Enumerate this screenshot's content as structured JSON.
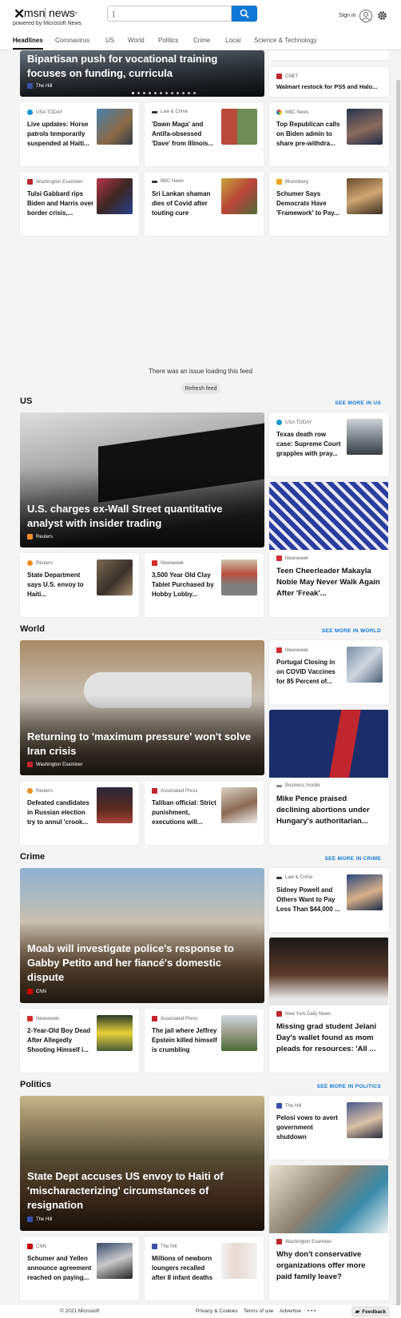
{
  "header": {
    "logo_mark": "✕",
    "logo": "msn",
    "brand": "news",
    "powered": "powered by Microsoft News",
    "search": {
      "value": "|",
      "placeholder": ""
    },
    "signin": "Sign in"
  },
  "nav": [
    "Headlines",
    "Coronavirus",
    "US",
    "World",
    "Politics",
    "Crime",
    "Local",
    "Science & Technology"
  ],
  "top": {
    "hero": {
      "title": "Bipartisan push for vocational training focuses on funding, curricula",
      "source": "The Hill"
    },
    "right": [
      {
        "source": "CNET",
        "title": "Walmart restock for PS5 and Halo..."
      }
    ],
    "rows": [
      [
        {
          "source": "USA TODAY",
          "title": "Live updates: Horse patrols temporarily suspended at Haiti..."
        },
        {
          "source": "Law & Crime",
          "title": "'Dawn Maga' and Antifa-obsessed 'Dave' from Illinois..."
        },
        {
          "source": "NBC News",
          "title": "Top Republican calls on Biden admin to share pre-withdra..."
        }
      ],
      [
        {
          "source": "Washington Examiner",
          "title": "Tulsi Gabbard rips Biden and Harris over border crisis,..."
        },
        {
          "source": "BBC News",
          "title": "Sri Lankan shaman dies of Covid after touting cure"
        },
        {
          "source": "Bloomberg",
          "title": "Schumer Says Democrats Have 'Framework' to Pay..."
        }
      ]
    ]
  },
  "feed": {
    "error": "There was an issue loading this feed",
    "refresh": "Refresh feed"
  },
  "sections": [
    {
      "title": "US",
      "see_more": "SEE MORE IN US",
      "hero": {
        "title": "U.S. charges ex-Wall Street quantitative analyst with insider trading",
        "source": "Reuters"
      },
      "right_small": {
        "source": "USA TODAY",
        "title": "Texas death row case: Supreme Court grapples with pray..."
      },
      "right_tall": {
        "source": "Newsweek",
        "title": "Teen Cheerleader Makayla Noble May Never Walk Again After 'Freak'..."
      },
      "bottom": [
        {
          "source": "Reuters",
          "title": "State Department says U.S. envoy to Haiti..."
        },
        {
          "source": "Newsweek",
          "title": "3,500 Year Old Clay Tablet Purchased by Hobby Lobby..."
        }
      ]
    },
    {
      "title": "World",
      "see_more": "SEE MORE IN WORLD",
      "hero": {
        "title": "Returning to 'maximum pressure' won't solve Iran crisis",
        "source": "Washington Examiner"
      },
      "right_small": {
        "source": "Newsweek",
        "title": "Portugal Closing in on COVID Vaccines for 85 Percent of..."
      },
      "right_tall": {
        "source": "Business Insider",
        "title": "Mike Pence praised declining abortions under Hungary's authoritarian..."
      },
      "bottom": [
        {
          "source": "Reuters",
          "title": "Defeated candidates in Russian election try to annul 'crook..."
        },
        {
          "source": "Associated Press",
          "title": "Taliban official: Strict punishment, executions will..."
        }
      ]
    },
    {
      "title": "Crime",
      "see_more": "SEE MORE IN CRIME",
      "hero": {
        "title": "Moab will investigate police's response to Gabby Petito and her fiancé's domestic dispute",
        "source": "CNN"
      },
      "right_small": {
        "source": "Law & Crime",
        "title": "Sidney Powell and Others Want to Pay Less Than $44,000 ..."
      },
      "right_tall": {
        "source": "New York Daily News",
        "title": "Missing grad student Jelani Day's wallet found as mom pleads for resources: 'All ..."
      },
      "bottom": [
        {
          "source": "Newsweek",
          "title": "2-Year-Old Boy Dead After Allegedly Shooting Himself i..."
        },
        {
          "source": "Associated Press",
          "title": "The jail where Jeffrey Epstein killed himself is crumbling"
        }
      ]
    },
    {
      "title": "Politics",
      "see_more": "SEE MORE IN POLITICS",
      "hero": {
        "title": "State Dept accuses US envoy to Haiti of 'mischaracterizing' circumstances of resignation",
        "source": "The Hill"
      },
      "right_small": {
        "source": "The Hill",
        "title": "Pelosi vows to avert government shutdown"
      },
      "right_tall": {
        "source": "Washington Examiner",
        "title": "Why don't conservative organizations offer more paid family leave?"
      },
      "bottom": [
        {
          "source": "CNN",
          "title": "Schumer and Yellen announce agreement reached on paying..."
        },
        {
          "source": "The Hill",
          "title": "Millions of newborn loungers recalled after 8 infant deaths"
        }
      ]
    }
  ],
  "footer": {
    "copyright": "© 2021 Microsoft",
    "links": [
      "Privacy & Cookies",
      "Terms of use",
      "Advertise"
    ],
    "more": "• • •",
    "feedback": "Feedback"
  }
}
